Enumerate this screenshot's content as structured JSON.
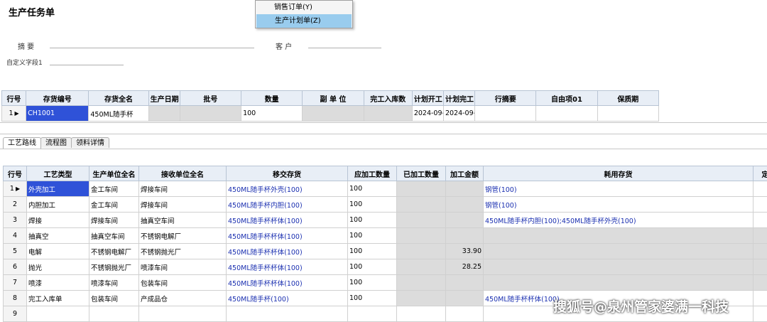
{
  "window": {
    "title": "生产任务单"
  },
  "context_menu": {
    "items": [
      {
        "label": "销售订单(Y)"
      },
      {
        "label": "生产计划单(Z)"
      }
    ]
  },
  "header_fields": {
    "summary_label": "摘    要",
    "customer_label": "客    户",
    "custom1_label": "自定义字段1"
  },
  "top_table": {
    "columns": [
      "行号",
      "存货编号",
      "存货全名",
      "生产日期",
      "批号",
      "数量",
      "副 单 位",
      "完工入库数",
      "计划开工",
      "计划完工",
      "行摘要",
      "自由项01",
      "保质期"
    ],
    "rows": [
      {
        "num": "1",
        "code": "CH1001",
        "name": "450ML随手杯",
        "prod_date": "",
        "batch": "",
        "qty": "100",
        "sub_unit": "",
        "done_qty": "",
        "plan_start": "2024-09-",
        "plan_end": "2024-09-",
        "memo": "",
        "free01": "",
        "shelf": ""
      }
    ]
  },
  "tabs": [
    {
      "label": "工艺路线"
    },
    {
      "label": "流程图"
    },
    {
      "label": "领料详情"
    }
  ],
  "process_table": {
    "columns": [
      "行号",
      "工艺类型",
      "生产单位全名",
      "接收单位全名",
      "移交存货",
      "应加工数量",
      "已加工数量",
      "加工金额",
      "耗用存货",
      "定额"
    ],
    "rows": [
      {
        "num": "1",
        "type": "外壳加工",
        "unit": "金工车间",
        "recv": "焊接车间",
        "transfer": "450ML随手杯外壳(100)",
        "plan_qty": "100",
        "done_qty": "",
        "amount": "",
        "consume": "钢管(100)"
      },
      {
        "num": "2",
        "type": "内胆加工",
        "unit": "金工车间",
        "recv": "焊接车间",
        "transfer": "450ML随手杯内胆(100)",
        "plan_qty": "100",
        "done_qty": "",
        "amount": "",
        "consume": "钢管(100)"
      },
      {
        "num": "3",
        "type": "焊接",
        "unit": "焊接车间",
        "recv": "抽真空车间",
        "transfer": "450ML随手杯杯体(100)",
        "plan_qty": "100",
        "done_qty": "",
        "amount": "",
        "consume": "450ML随手杯内胆(100);450ML随手杯外壳(100)"
      },
      {
        "num": "4",
        "type": "抽真空",
        "unit": "抽真空车间",
        "recv": "不锈钢电解厂",
        "transfer": "450ML随手杯杯体(100)",
        "plan_qty": "100",
        "done_qty": "",
        "amount": "",
        "consume": ""
      },
      {
        "num": "5",
        "type": "电解",
        "unit": "不锈钢电解厂",
        "recv": "不锈钢抛光厂",
        "transfer": "450ML随手杯杯体(100)",
        "plan_qty": "100",
        "done_qty": "",
        "amount": "33.90",
        "consume": ""
      },
      {
        "num": "6",
        "type": "抛光",
        "unit": "不锈钢抛光厂",
        "recv": "喷漆车间",
        "transfer": "450ML随手杯杯体(100)",
        "plan_qty": "100",
        "done_qty": "",
        "amount": "28.25",
        "consume": ""
      },
      {
        "num": "7",
        "type": "喷漆",
        "unit": "喷漆车间",
        "recv": "包装车间",
        "transfer": "450ML随手杯杯体(100)",
        "plan_qty": "100",
        "done_qty": "",
        "amount": "",
        "consume": ""
      },
      {
        "num": "8",
        "type": "完工入库单",
        "unit": "包装车间",
        "recv": "产成品仓",
        "transfer": "450ML随手杯(100)",
        "plan_qty": "100",
        "done_qty": "",
        "amount": "",
        "consume": "450ML随手杯杯体(100)"
      },
      {
        "num": "9",
        "type": "",
        "unit": "",
        "recv": "",
        "transfer": "",
        "plan_qty": "",
        "done_qty": "",
        "amount": "",
        "consume": ""
      }
    ]
  },
  "watermark": "搜狐号@泉州管家婆满一科技"
}
